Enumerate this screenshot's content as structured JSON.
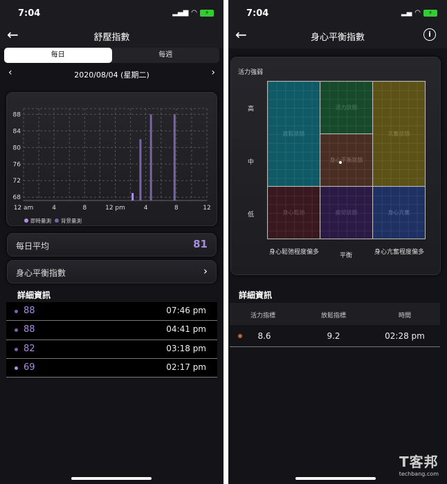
{
  "left": {
    "status_time": "7:04",
    "title": "舒壓指數",
    "tabs": [
      {
        "label": "每日",
        "active": true
      },
      {
        "label": "每週",
        "active": false
      }
    ],
    "date": "2020/08/04 (星期二)",
    "daily_average_label": "每日平均",
    "daily_average_value": "81",
    "balance_link_label": "身心平衡指數",
    "details_title": "詳細資訊",
    "details": [
      {
        "value": "88",
        "time": "07:46 pm",
        "type": "背景量測"
      },
      {
        "value": "88",
        "time": "04:41 pm",
        "type": "背景量測"
      },
      {
        "value": "82",
        "time": "03:18 pm",
        "type": "背景量測"
      },
      {
        "value": "69",
        "time": "02:17 pm",
        "type": "即時量測"
      }
    ]
  },
  "chart_data": {
    "type": "bar",
    "x_ticks": [
      "12 am",
      "4",
      "8",
      "12 pm",
      "4",
      "8",
      "12"
    ],
    "y_ticks": [
      "68",
      "72",
      "76",
      "80",
      "84",
      "88"
    ],
    "xlim": [
      0,
      24
    ],
    "ylim": [
      67.2,
      89.4
    ],
    "grid": true,
    "legend": "bottom-left",
    "series": [
      {
        "name": "即時量測",
        "color": "#b48cf0",
        "points": [
          {
            "hour": 14.28,
            "value": 69
          }
        ]
      },
      {
        "name": "背景量測",
        "color": "#7a64a8",
        "points": [
          {
            "hour": 15.3,
            "value": 82
          },
          {
            "hour": 16.68,
            "value": 88
          },
          {
            "hour": 19.77,
            "value": 88
          }
        ]
      }
    ]
  },
  "right": {
    "status_time": "7:04",
    "title": "身心平衡指數",
    "y_axis_title": "活力強弱",
    "y_labels": [
      "高",
      "中",
      "低"
    ],
    "x_labels": [
      "身心鬆弛程度偏多",
      "平衡",
      "身心亢奮程度偏多"
    ],
    "zones": {
      "relaxed": {
        "label": "放鬆狀態",
        "color": "#0f5a66"
      },
      "vital": {
        "label": "活力狀態",
        "color": "#174a2a"
      },
      "excited": {
        "label": "亢奮狀態",
        "color": "#5c5218"
      },
      "balanced": {
        "label": "身心平衡狀態",
        "color": "#4a2e24"
      },
      "loose": {
        "label": "身心鬆弛",
        "color": "#3a1820"
      },
      "fatigue": {
        "label": "疲勞狀態",
        "color": "#2b1a45"
      },
      "hyper": {
        "label": "身心亢奮",
        "color": "#1f3163"
      }
    },
    "details_title": "詳細資訊",
    "table_headers": [
      "活力指標",
      "放鬆指標",
      "時間"
    ],
    "table_rows": [
      {
        "vitality": "8.6",
        "relax": "9.2",
        "time": "02:28 pm",
        "dot_color": "#c0602c"
      }
    ]
  },
  "watermark": {
    "brand": "T客邦",
    "site": "techbang.com"
  }
}
